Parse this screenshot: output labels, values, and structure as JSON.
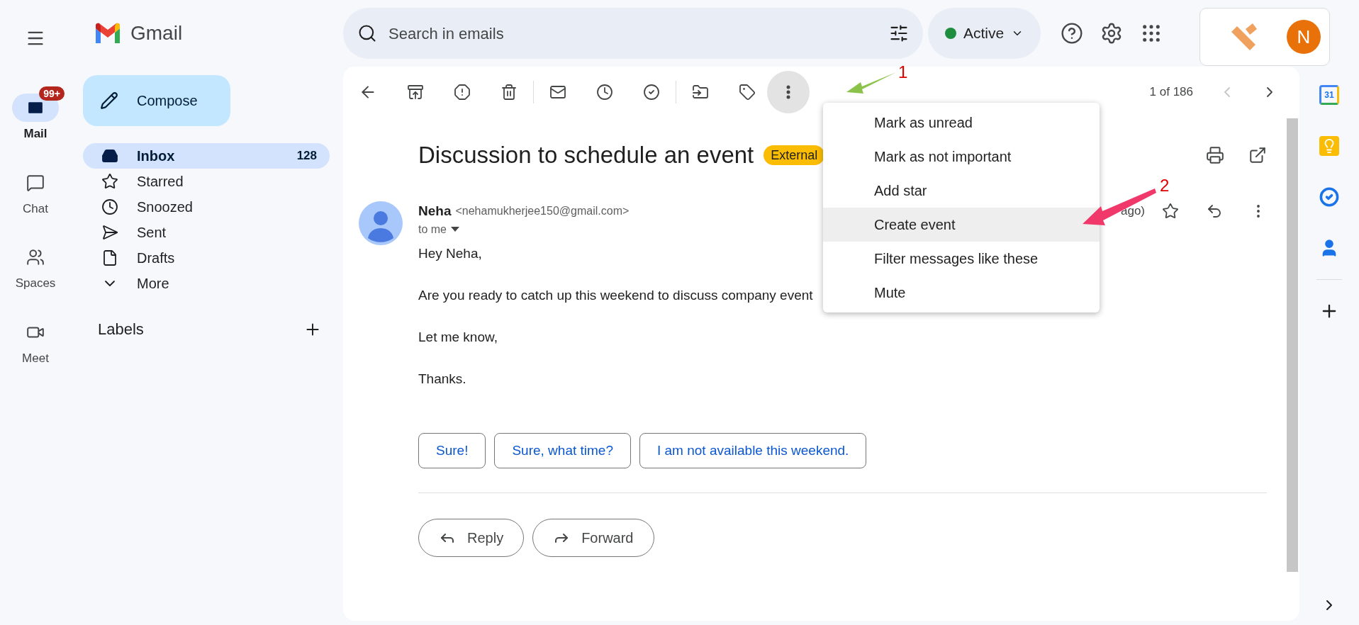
{
  "app": {
    "name": "Gmail"
  },
  "rail": [
    {
      "label": "Mail",
      "selected": true,
      "badge": "99+"
    },
    {
      "label": "Chat",
      "selected": false
    },
    {
      "label": "Spaces",
      "selected": false
    },
    {
      "label": "Meet",
      "selected": false
    }
  ],
  "search": {
    "placeholder": "Search in emails"
  },
  "status": {
    "label": "Active",
    "color": "#1e8e3e"
  },
  "account": {
    "initial": "N"
  },
  "compose": "Compose",
  "folders": [
    {
      "label": "Inbox",
      "count": "128",
      "selected": true
    },
    {
      "label": "Starred",
      "selected": false
    },
    {
      "label": "Snoozed",
      "selected": false
    },
    {
      "label": "Sent",
      "selected": false
    },
    {
      "label": "Drafts",
      "selected": false
    },
    {
      "label": "More",
      "selected": false
    }
  ],
  "labels_heading": "Labels",
  "pager": "1 of 186",
  "message": {
    "subject": "Discussion to schedule an event",
    "tag": "External",
    "sender_name": "Neha",
    "sender_email": "<nehamukherjee150@gmail.com>",
    "time": "ago)",
    "recipient": "to me",
    "body": [
      "Hey Neha,",
      "Are you ready to catch up this weekend to discuss company event",
      "Let me know,",
      "Thanks."
    ]
  },
  "smart_replies": [
    "Sure!",
    "Sure, what time?",
    "I am not available this weekend."
  ],
  "actions": [
    "Reply",
    "Forward"
  ],
  "menu": [
    {
      "label": "Mark as unread",
      "selected": false
    },
    {
      "label": "Mark as not important",
      "selected": false
    },
    {
      "label": "Add star",
      "selected": false
    },
    {
      "label": "Create event",
      "selected": true
    },
    {
      "label": "Filter messages like these",
      "selected": false
    },
    {
      "label": "Mute",
      "selected": false
    }
  ],
  "side_panel": {
    "calendar_day": "31"
  },
  "annotations": [
    {
      "label": "1",
      "color": "#8bc34a"
    },
    {
      "label": "2",
      "color": "#f0386b"
    }
  ]
}
